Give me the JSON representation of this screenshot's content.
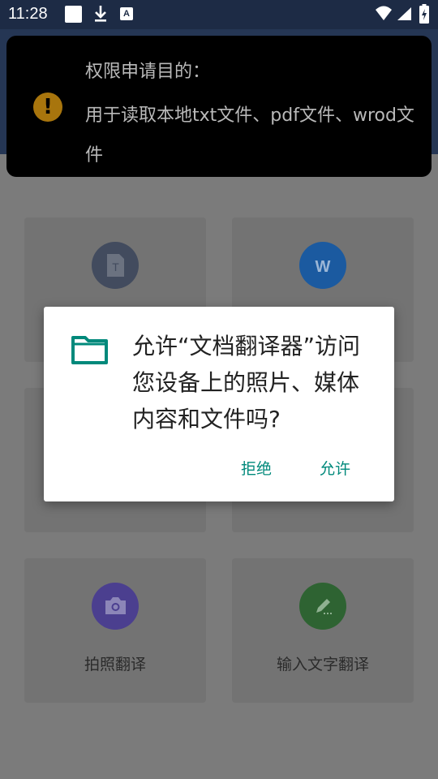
{
  "status_bar": {
    "time": "11:28",
    "notification_letter": "A"
  },
  "toast": {
    "title": "权限申请目的：",
    "message": "用于读取本地txt文件、pdf文件、wrod文件",
    "warn_symbol": "!"
  },
  "cards": [
    {
      "label": "",
      "icon": "text-file-icon",
      "color": "#424b5e"
    },
    {
      "label": "",
      "icon": "word-icon",
      "letter": "W",
      "color": "#1b5aa0"
    },
    {
      "label": "拍照翻译",
      "icon": "camera-icon",
      "color": "#4b3f8f"
    },
    {
      "label": "输入文字翻译",
      "icon": "pencil-icon",
      "color": "#2e6332"
    }
  ],
  "dialog": {
    "icon": "folder-icon",
    "message": "允许“文档翻译器”访问您设备上的照片、媒体内容和文件吗?",
    "deny_label": "拒绝",
    "allow_label": "允许",
    "accent_color": "#00897b"
  }
}
